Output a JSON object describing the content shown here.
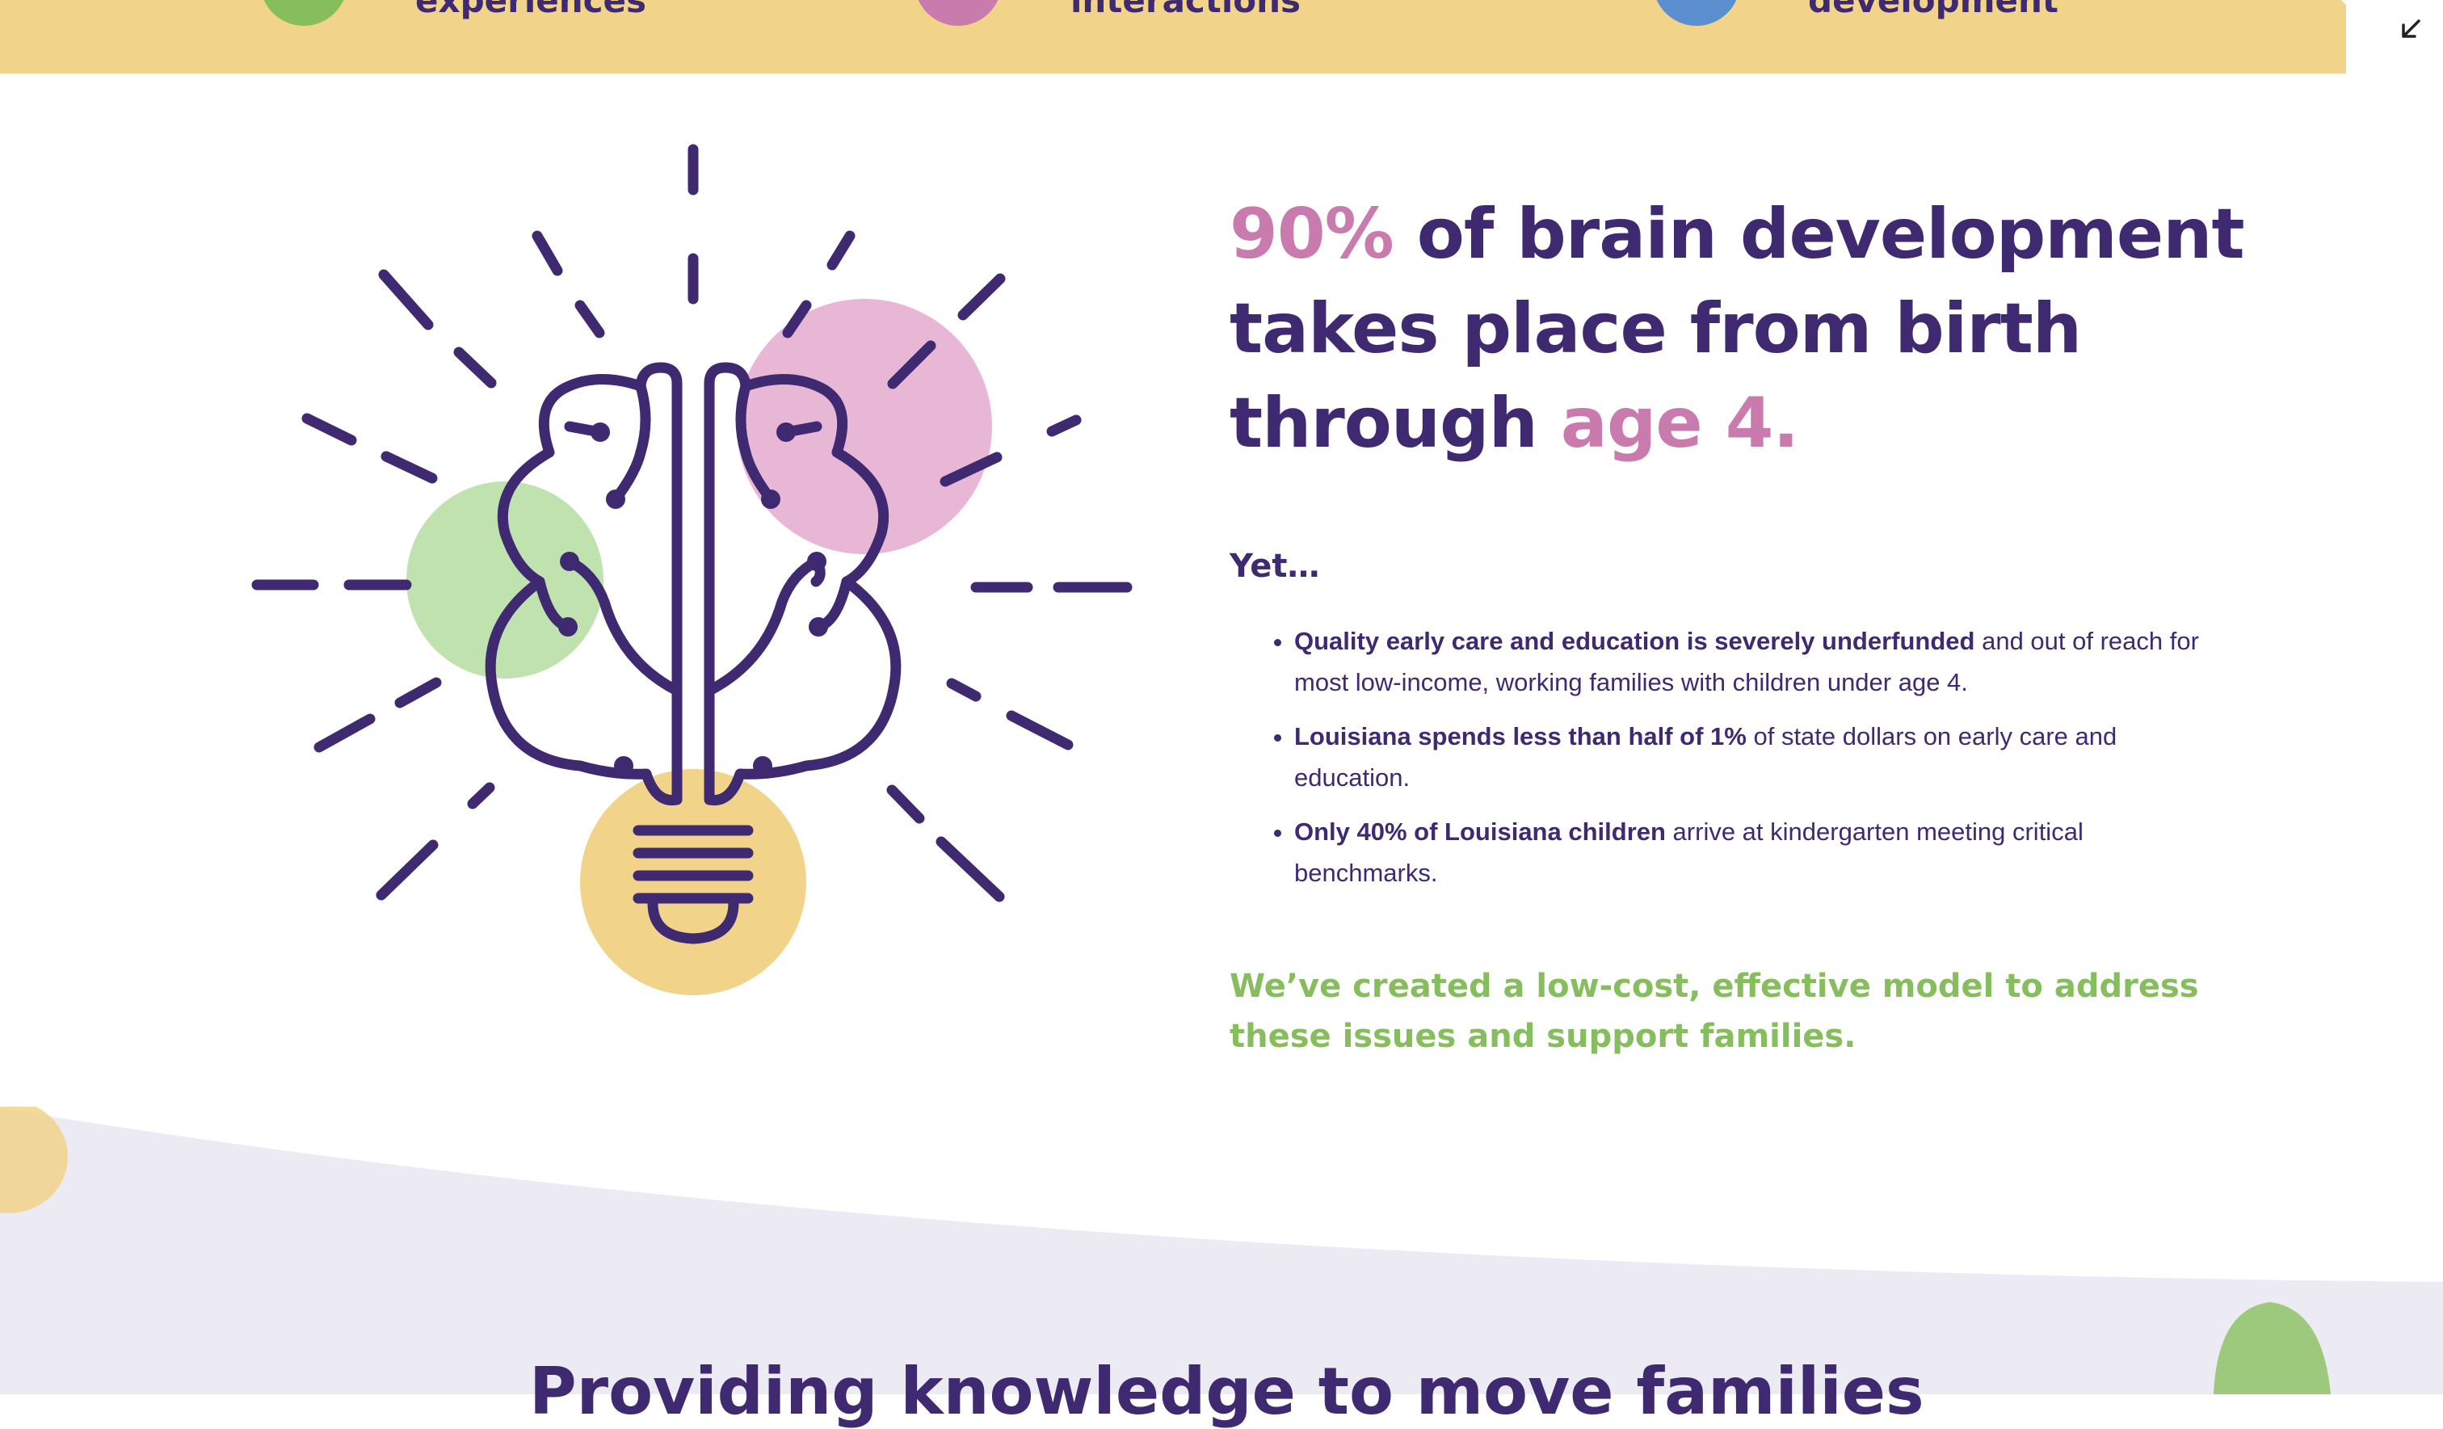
{
  "top_band": {
    "color": "#F1D48A",
    "items": [
      {
        "label": "experiences",
        "dot_color": "#86BE5E"
      },
      {
        "label": "interactions",
        "dot_color": "#C97BAE"
      },
      {
        "label": "development",
        "dot_color": "#5B8FD0"
      }
    ]
  },
  "corner_button": {
    "icon": "collapse-arrow-icon"
  },
  "illustration": {
    "icon": "brain-lightbulb-icon",
    "colors": {
      "line": "#3F2A72",
      "green": "#BFE2AE",
      "pink": "#E8B7D6",
      "yellow": "#F1D48A"
    }
  },
  "headline": {
    "highlight_1": "90%",
    "middle": " of brain development takes place from birth through ",
    "highlight_2": "age 4."
  },
  "yet_label": "Yet…",
  "bullets": [
    {
      "bold": "Quality early care and education is severely underfunded",
      "rest": " and out of reach for most low-income, working families with children under age 4."
    },
    {
      "bold": "Louisiana spends less than half of 1%",
      "rest": " of state dollars on early care and education."
    },
    {
      "bold": "Only 40% of Louisiana children",
      "rest": " arrive at kindergarten meeting critical benchmarks."
    }
  ],
  "callout": "We’ve created a low-cost, effective model to address these issues and support families.",
  "next_section": {
    "title": "Providing knowledge to move families"
  },
  "colors": {
    "primary": "#3F2A72",
    "accent_pink": "#C97BAE",
    "accent_green": "#86BE5E",
    "band_yellow": "#F1D48A",
    "lavender": "#ECEAF2"
  }
}
